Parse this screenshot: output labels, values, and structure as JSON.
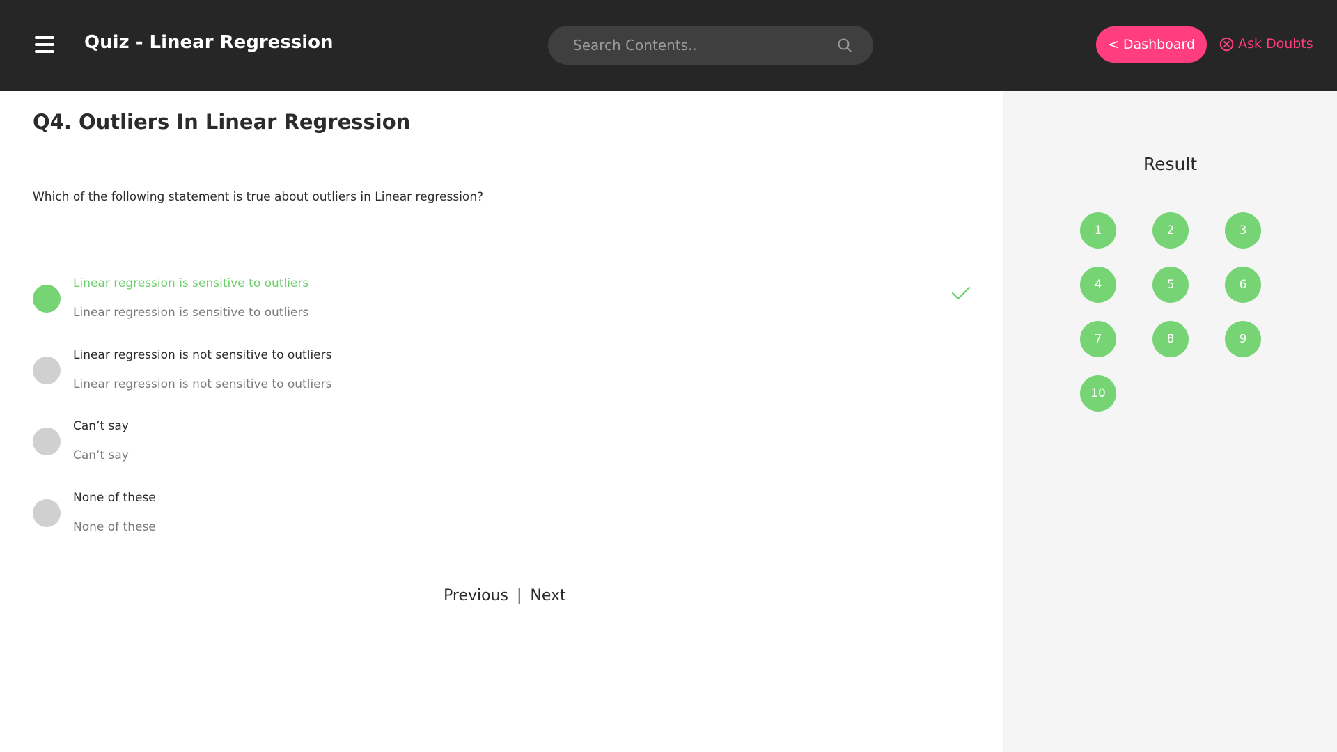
{
  "header": {
    "title": "Quiz - Linear Regression",
    "search_placeholder": "Search Contents..",
    "dashboard_label": "< Dashboard",
    "ask_doubts_label": "Ask Doubts",
    "accent_color": "#ff3d7f"
  },
  "question": {
    "title": "Q4. Outliers In Linear Regression",
    "text": "Which of the following statement is true about outliers in Linear regression?",
    "options": [
      {
        "label": "Linear regression is sensitive to outliers",
        "sub": "Linear regression is sensitive to outliers",
        "selected": true,
        "correct": true
      },
      {
        "label": "Linear regression is not sensitive to outliers",
        "sub": "Linear regression is not sensitive to outliers",
        "selected": false
      },
      {
        "label": "Can’t say",
        "sub": "Can’t say",
        "selected": false
      },
      {
        "label": "None of these",
        "sub": "None of these",
        "selected": false
      }
    ]
  },
  "pager": {
    "previous": "Previous",
    "separator": "|",
    "next": "Next"
  },
  "sidebar": {
    "title": "Result",
    "question_numbers": [
      "1",
      "2",
      "3",
      "4",
      "5",
      "6",
      "7",
      "8",
      "9",
      "10"
    ],
    "answered_color": "#76d475"
  },
  "icons": {
    "menu": "hamburger-icon",
    "search": "search-icon",
    "ask": "close-circle-icon",
    "correct": "checkmark-icon"
  }
}
